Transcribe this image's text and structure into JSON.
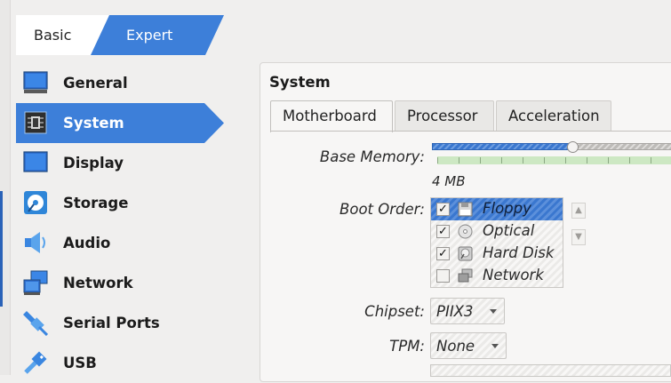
{
  "mode_tabs": {
    "basic": "Basic",
    "expert": "Expert"
  },
  "sidebar": {
    "items": [
      {
        "label": "General",
        "icon": "general-icon"
      },
      {
        "label": "System",
        "icon": "system-icon",
        "active": true
      },
      {
        "label": "Display",
        "icon": "display-icon"
      },
      {
        "label": "Storage",
        "icon": "storage-icon"
      },
      {
        "label": "Audio",
        "icon": "audio-icon"
      },
      {
        "label": "Network",
        "icon": "network-icon"
      },
      {
        "label": "Serial Ports",
        "icon": "serial-ports-icon"
      },
      {
        "label": "USB",
        "icon": "usb-icon"
      }
    ]
  },
  "main": {
    "title": "System",
    "tabs": [
      {
        "label": "Motherboard",
        "active": true
      },
      {
        "label": "Processor"
      },
      {
        "label": "Acceleration"
      }
    ],
    "base_memory": {
      "label": "Base Memory:",
      "value": "4 MB"
    },
    "boot_order": {
      "label": "Boot Order:",
      "items": [
        {
          "label": "Floppy",
          "checked": true,
          "icon": "floppy-icon",
          "selected": true
        },
        {
          "label": "Optical",
          "checked": true,
          "icon": "optical-disc-icon"
        },
        {
          "label": "Hard Disk",
          "checked": true,
          "icon": "hard-disk-icon"
        },
        {
          "label": "Network",
          "checked": false,
          "icon": "network-boot-icon"
        }
      ]
    },
    "chipset": {
      "label": "Chipset:",
      "value": "PIIX3"
    },
    "tpm": {
      "label": "TPM:",
      "value": "None"
    }
  },
  "colors": {
    "accent": "#3d7fd9",
    "selection": "#3a77cf"
  }
}
